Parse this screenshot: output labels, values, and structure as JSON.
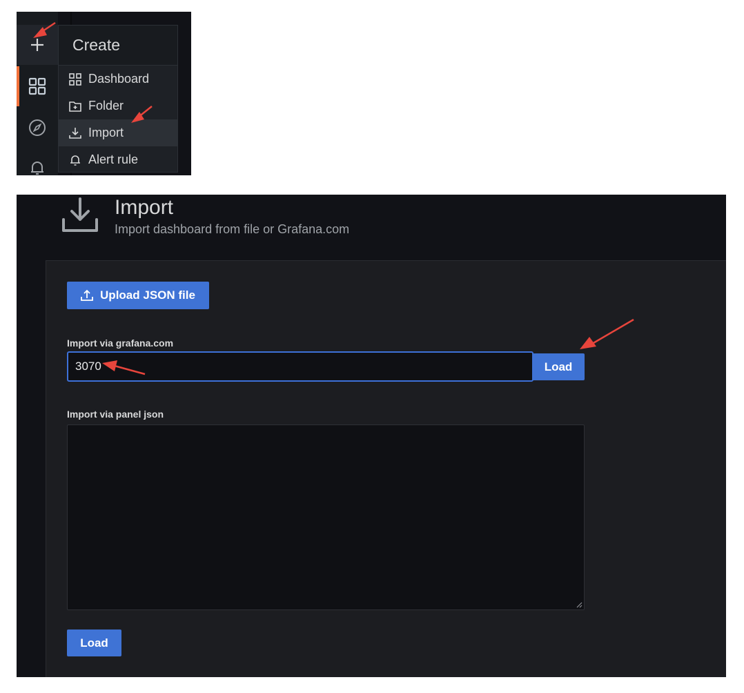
{
  "create_menu": {
    "header": "Create",
    "items": [
      {
        "label": "Dashboard",
        "icon": "apps-icon"
      },
      {
        "label": "Folder",
        "icon": "folder-plus-icon"
      },
      {
        "label": "Import",
        "icon": "import-icon",
        "highlighted": true
      },
      {
        "label": "Alert rule",
        "icon": "bell-icon"
      }
    ]
  },
  "sidenav": {
    "items": [
      {
        "icon": "plus-icon",
        "active": true
      },
      {
        "icon": "apps-icon",
        "selected": true
      },
      {
        "icon": "compass-icon"
      },
      {
        "icon": "bell-icon"
      }
    ],
    "accent_color": "#f2713a"
  },
  "import_page": {
    "title": "Import",
    "subtitle": "Import dashboard from file or Grafana.com",
    "upload_button": "Upload JSON file",
    "grafana_label": "Import via grafana.com",
    "grafana_value": "3070",
    "grafana_load_button": "Load",
    "panel_json_label": "Import via panel json",
    "panel_json_value": "",
    "load_button": "Load"
  },
  "colors": {
    "primary_button": "#3f73d5",
    "background": "#111217",
    "annotation_arrow": "#e8453c"
  }
}
